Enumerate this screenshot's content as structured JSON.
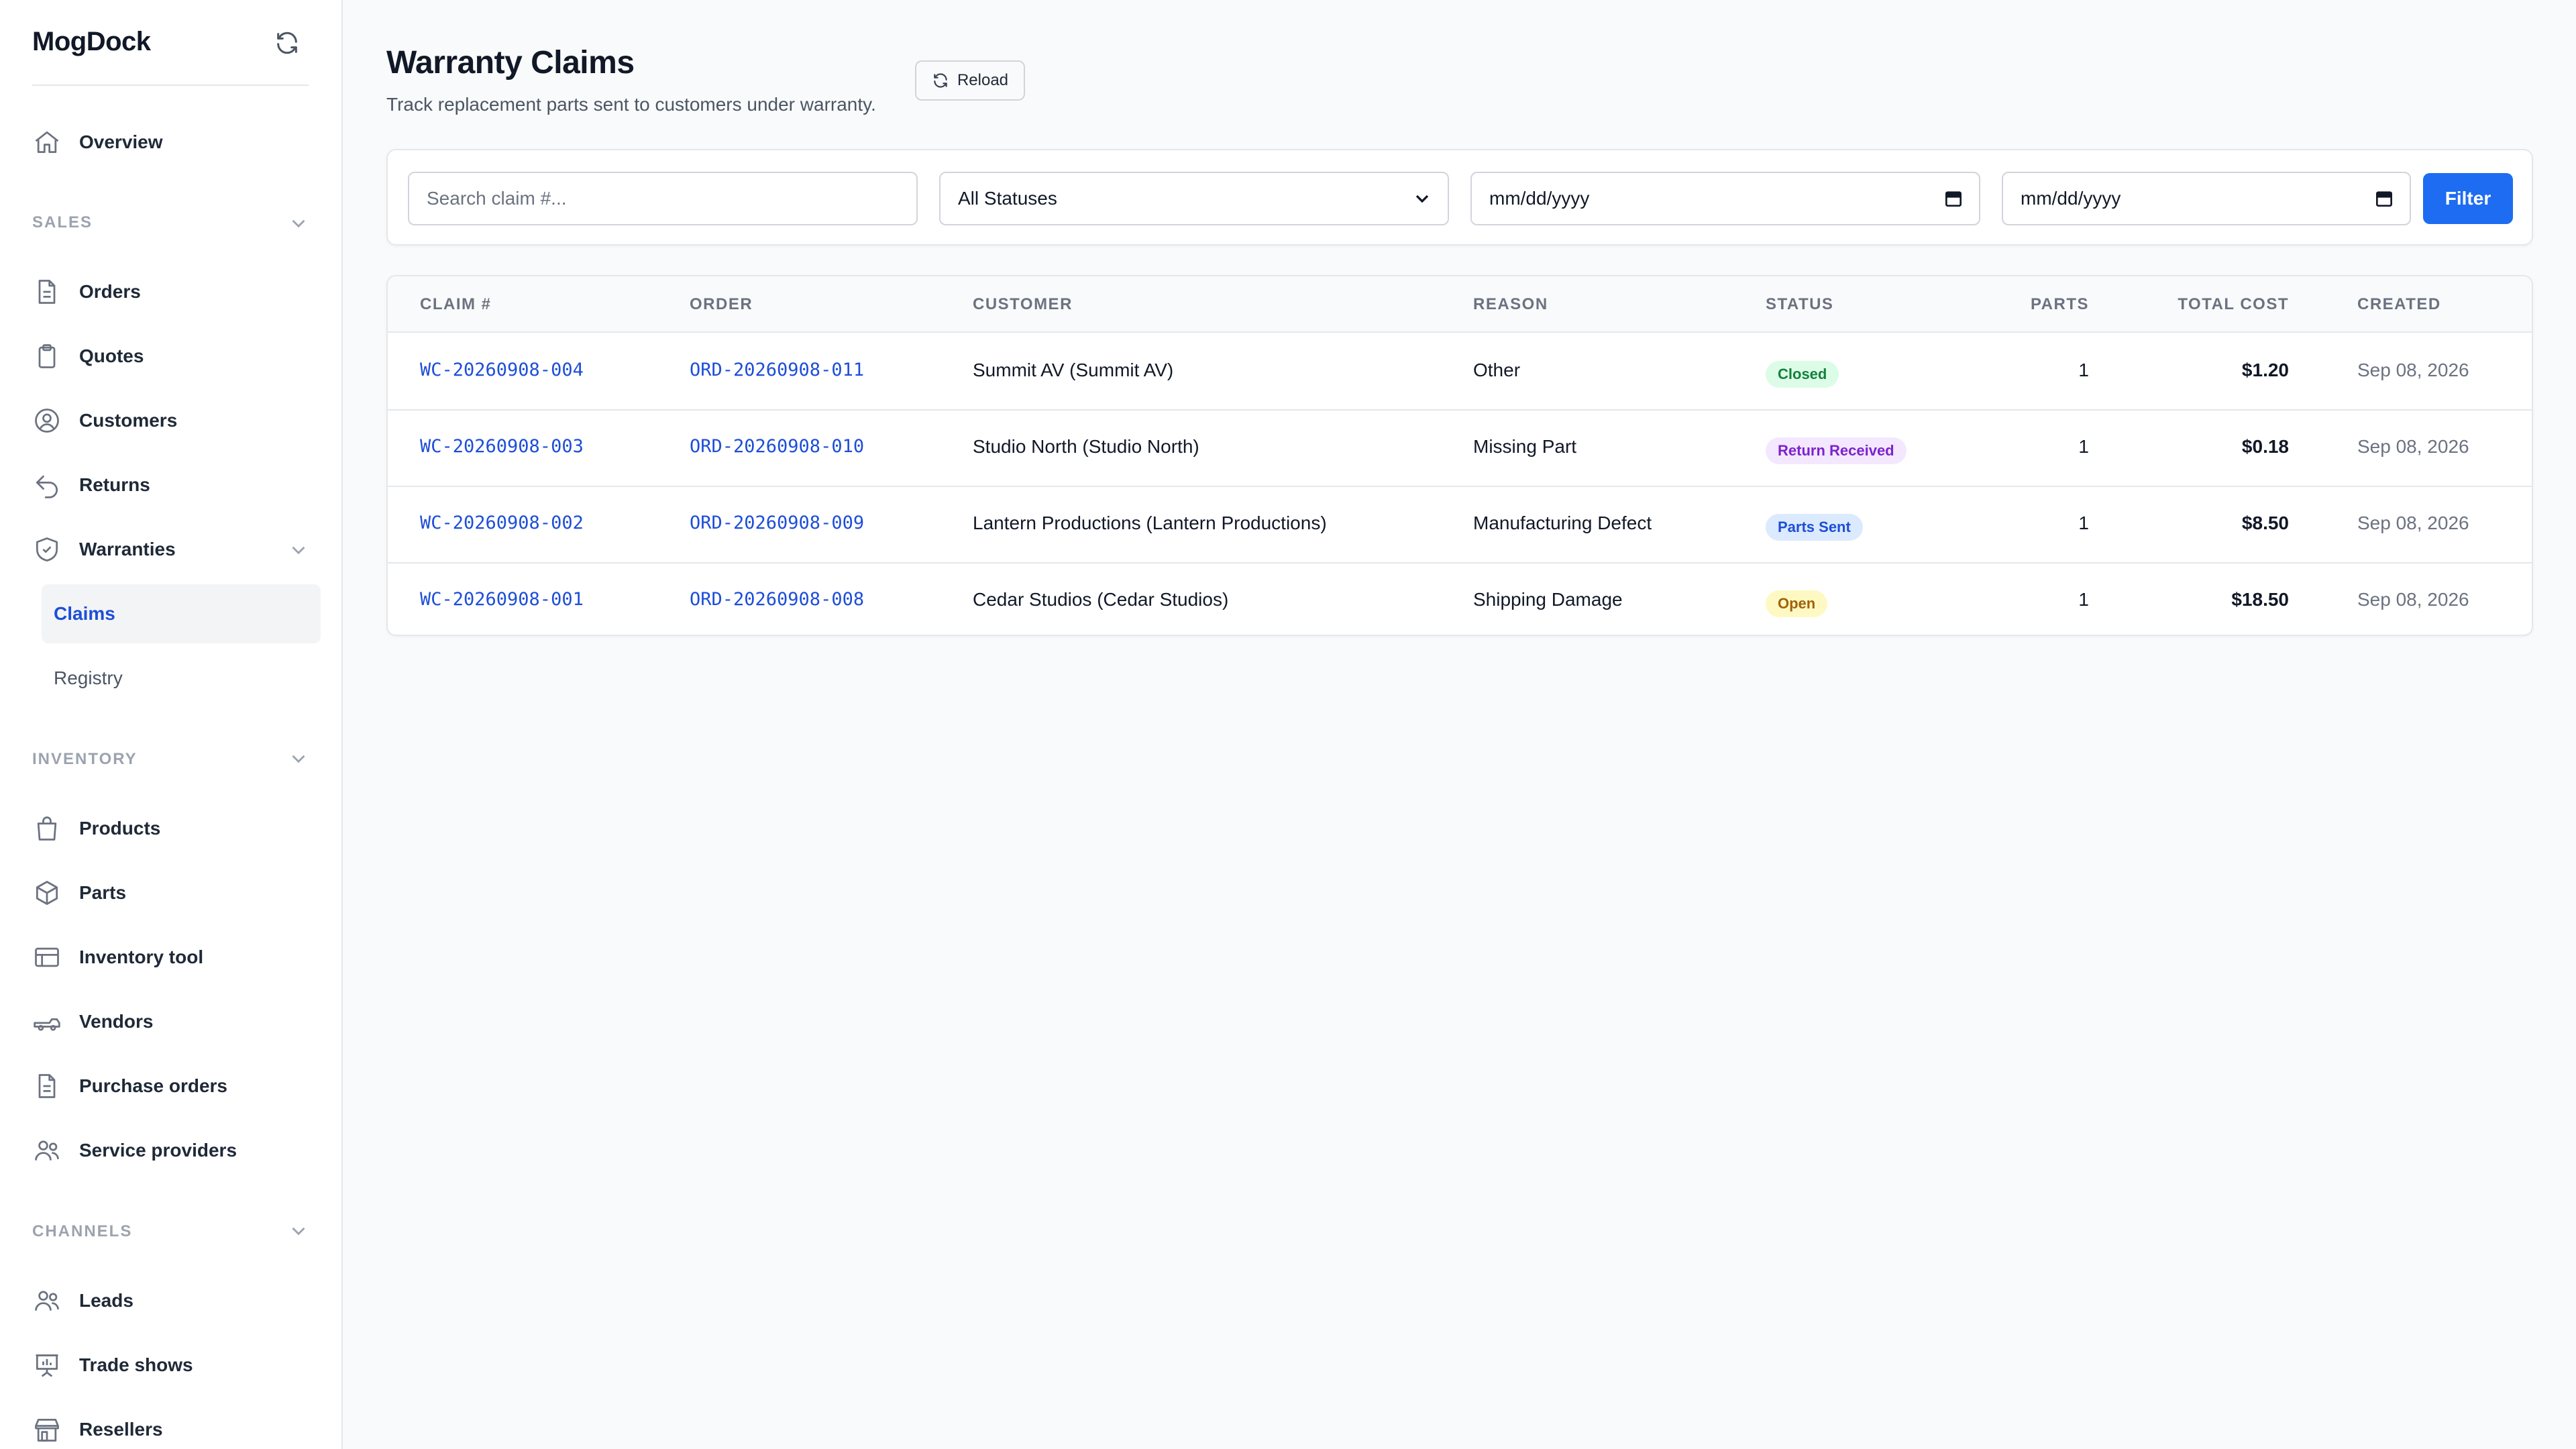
{
  "app": {
    "name": "MogDock"
  },
  "sidebar": {
    "top_items": [
      {
        "label": "Overview",
        "icon": "home-icon"
      }
    ],
    "sections": [
      {
        "label": "SALES",
        "items": [
          {
            "label": "Orders",
            "icon": "document-icon"
          },
          {
            "label": "Quotes",
            "icon": "clipboard-icon"
          },
          {
            "label": "Customers",
            "icon": "user-circle-icon"
          },
          {
            "label": "Returns",
            "icon": "return-arrow-icon"
          },
          {
            "label": "Warranties",
            "icon": "shield-icon",
            "expanded": true,
            "children": [
              {
                "label": "Claims",
                "active": true
              },
              {
                "label": "Registry",
                "active": false
              }
            ]
          }
        ]
      },
      {
        "label": "INVENTORY",
        "items": [
          {
            "label": "Products",
            "icon": "shopping-bag-icon"
          },
          {
            "label": "Parts",
            "icon": "cube-icon"
          },
          {
            "label": "Inventory tool",
            "icon": "table-icon"
          },
          {
            "label": "Vendors",
            "icon": "truck-icon"
          },
          {
            "label": "Purchase orders",
            "icon": "document-icon"
          },
          {
            "label": "Service providers",
            "icon": "users-icon"
          }
        ]
      },
      {
        "label": "CHANNELS",
        "items": [
          {
            "label": "Leads",
            "icon": "users-icon"
          },
          {
            "label": "Trade shows",
            "icon": "presentation-icon"
          },
          {
            "label": "Resellers",
            "icon": "storefront-icon"
          }
        ]
      }
    ]
  },
  "page": {
    "title": "Warranty Claims",
    "subtitle": "Track replacement parts sent to customers under warranty.",
    "reload_label": "Reload"
  },
  "filters": {
    "search_placeholder": "Search claim #...",
    "status_selected": "All Statuses",
    "date_from": "mm/dd/yyyy",
    "date_to": "mm/dd/yyyy",
    "filter_label": "Filter"
  },
  "table": {
    "columns": [
      "CLAIM #",
      "ORDER",
      "CUSTOMER",
      "REASON",
      "STATUS",
      "PARTS",
      "TOTAL COST",
      "CREATED"
    ],
    "rows": [
      {
        "claim": "WC-20260908-004",
        "order": "ORD-20260908-011",
        "customer": "Summit AV (Summit AV)",
        "reason": "Other",
        "status": "Closed",
        "parts": "1",
        "total": "$1.20",
        "created": "Sep 08, 2026"
      },
      {
        "claim": "WC-20260908-003",
        "order": "ORD-20260908-010",
        "customer": "Studio North (Studio North)",
        "reason": "Missing Part",
        "status": "Return Received",
        "parts": "1",
        "total": "$0.18",
        "created": "Sep 08, 2026"
      },
      {
        "claim": "WC-20260908-002",
        "order": "ORD-20260908-009",
        "customer": "Lantern Productions (Lantern Productions)",
        "reason": "Manufacturing Defect",
        "status": "Parts Sent",
        "parts": "1",
        "total": "$8.50",
        "created": "Sep 08, 2026"
      },
      {
        "claim": "WC-20260908-001",
        "order": "ORD-20260908-008",
        "customer": "Cedar Studios (Cedar Studios)",
        "reason": "Shipping Damage",
        "status": "Open",
        "parts": "1",
        "total": "$18.50",
        "created": "Sep 08, 2026"
      }
    ]
  },
  "status_colors": {
    "Closed": {
      "bg": "#dcfce7",
      "fg": "#15803d"
    },
    "Return Received": {
      "bg": "#f3e8ff",
      "fg": "#7e22ce"
    },
    "Parts Sent": {
      "bg": "#dbeafe",
      "fg": "#1d4ed8"
    },
    "Open": {
      "bg": "#fef9c3",
      "fg": "#a16207"
    }
  },
  "colors": {
    "accent": "#1d6cf2",
    "link": "#1d4ed8"
  }
}
